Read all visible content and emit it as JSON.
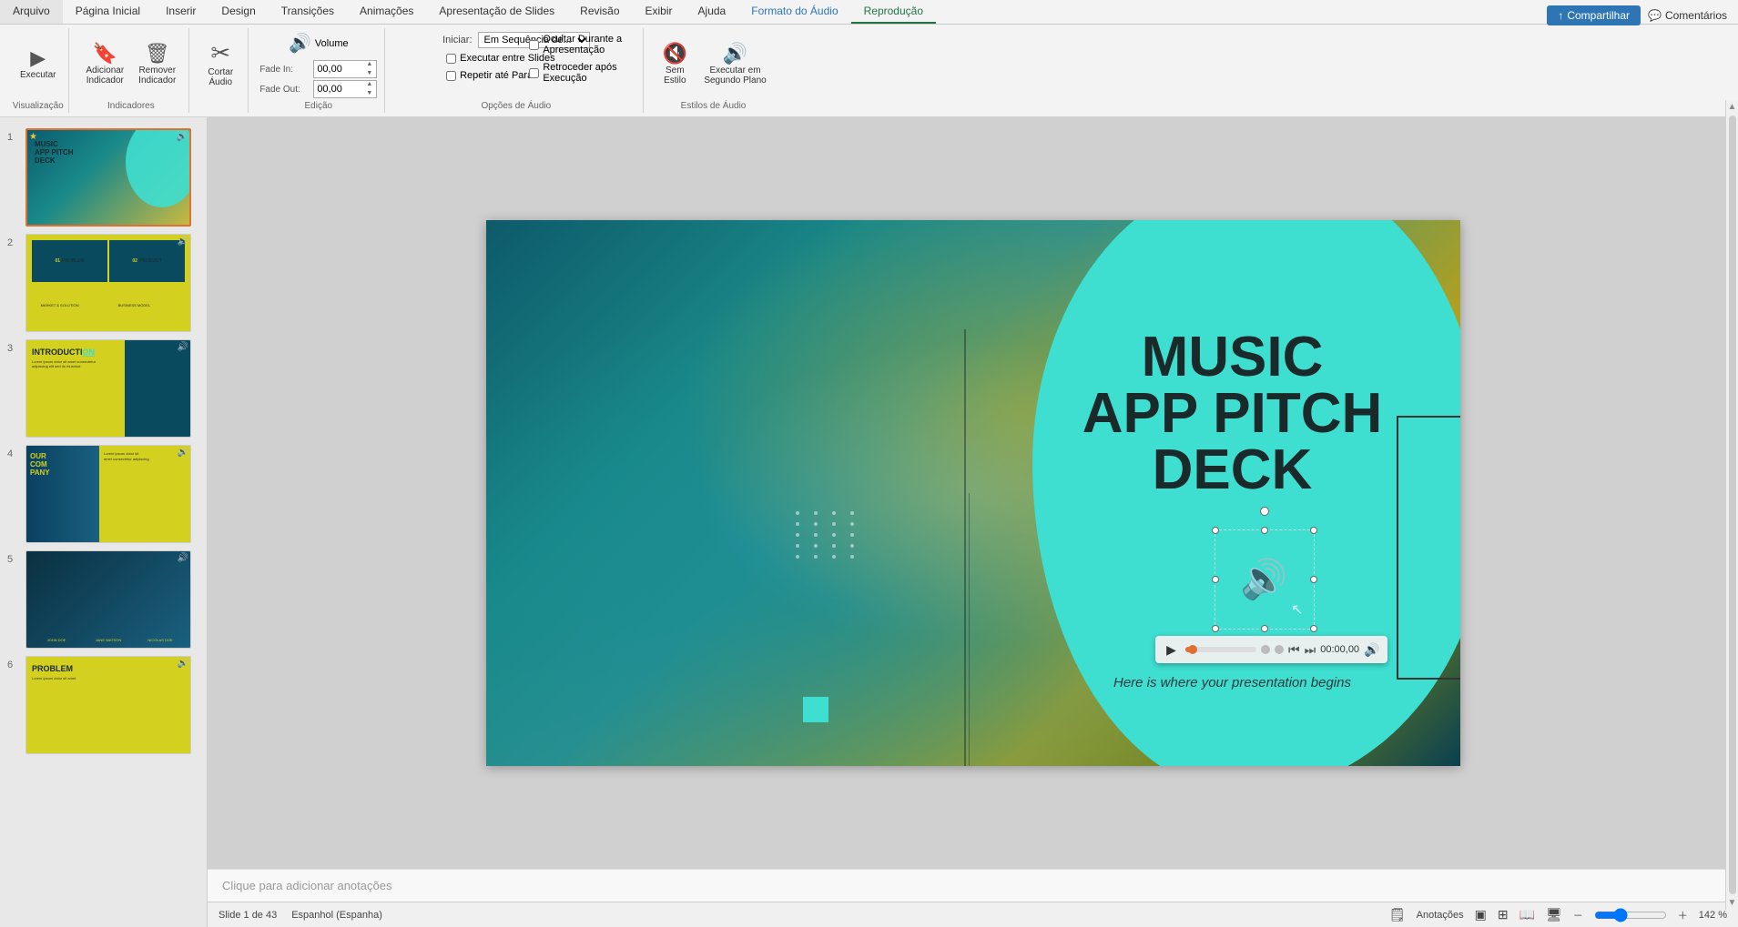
{
  "app": {
    "title": "PowerPoint"
  },
  "ribbon": {
    "tabs": [
      {
        "id": "arquivo",
        "label": "Arquivo"
      },
      {
        "id": "pagina-inicial",
        "label": "Página Inicial"
      },
      {
        "id": "inserir",
        "label": "Inserir"
      },
      {
        "id": "design",
        "label": "Design"
      },
      {
        "id": "transicoes",
        "label": "Transições"
      },
      {
        "id": "animacoes",
        "label": "Animações"
      },
      {
        "id": "apresentacao",
        "label": "Apresentação de Slides"
      },
      {
        "id": "revisao",
        "label": "Revisão"
      },
      {
        "id": "exibir",
        "label": "Exibir"
      },
      {
        "id": "ajuda",
        "label": "Ajuda"
      },
      {
        "id": "formato-audio",
        "label": "Formato do Áudio"
      },
      {
        "id": "reproducao",
        "label": "Reprodução",
        "active": true
      }
    ],
    "groups": {
      "visualizacao": {
        "label": "Visualização",
        "buttons": [
          {
            "id": "executar",
            "label": "Executar",
            "icon": "▶"
          }
        ]
      },
      "indicadores": {
        "label": "Indicadores",
        "buttons": [
          {
            "id": "adicionar-indicador",
            "label": "Adicionar\nIndicador",
            "icon": "◈"
          },
          {
            "id": "remover-indicador",
            "label": "Remover\nIndicador",
            "icon": "◉"
          }
        ]
      },
      "cortar-audio": {
        "label": "Edição",
        "buttons": [
          {
            "id": "cortar-audio",
            "label": "Cortar\nÁudio",
            "icon": "✂"
          }
        ]
      },
      "volume": {
        "label": "Volume",
        "icon": "🔊"
      },
      "audio-options": {
        "label": "Opções de Áudio",
        "iniciar_label": "Iniciar:",
        "iniciar_value": "Em Sequência de...",
        "checkboxes": [
          {
            "id": "executar-slides",
            "label": "Executar entre Slides"
          },
          {
            "id": "repetir",
            "label": "Repetir até Parar"
          }
        ],
        "checkboxes2": [
          {
            "id": "ocultar",
            "label": "Ocultar Durante a Apresentação"
          },
          {
            "id": "retroceder",
            "label": "Retroceder após Execução"
          }
        ],
        "fade_in_label": "Fade In:",
        "fade_in_value": "00,00",
        "fade_out_label": "Fade Out:",
        "fade_out_value": "00,00"
      },
      "estilos-audio": {
        "label": "Estilos de Áudio",
        "buttons": [
          {
            "id": "sem-estilo",
            "label": "Sem\nEstilo",
            "icon": "🔇"
          },
          {
            "id": "segundo-plano",
            "label": "Executar em\nSegundo Plano",
            "icon": "🔊"
          }
        ]
      }
    }
  },
  "topright": {
    "share_label": "Compartilhar",
    "comments_label": "Comentários"
  },
  "slides": [
    {
      "num": "1",
      "selected": true,
      "starred": true,
      "type": "title",
      "thumb_bg": "thumb-1"
    },
    {
      "num": "2",
      "selected": false,
      "type": "agenda",
      "thumb_bg": "thumb-2"
    },
    {
      "num": "3",
      "selected": false,
      "type": "intro",
      "thumb_bg": "thumb-3"
    },
    {
      "num": "4",
      "selected": false,
      "type": "company",
      "thumb_bg": "thumb-4"
    },
    {
      "num": "5",
      "selected": false,
      "type": "team",
      "thumb_bg": "thumb-5"
    },
    {
      "num": "6",
      "selected": false,
      "type": "problem",
      "thumb_bg": "thumb-6"
    }
  ],
  "main_slide": {
    "title_line1": "MUSIC",
    "title_line2": "APP PITCH",
    "title_line3": "DECK",
    "subtitle": "Here is where your presentation begins"
  },
  "audio_playbar": {
    "time": "00:00,00",
    "volume_icon": "🔊"
  },
  "notes": {
    "placeholder": "Clique para adicionar anotações"
  },
  "status": {
    "slide_info": "Slide 1 de 43",
    "language": "Espanhol (Espanha)",
    "notes_label": "Anotações",
    "zoom": "142 %"
  }
}
